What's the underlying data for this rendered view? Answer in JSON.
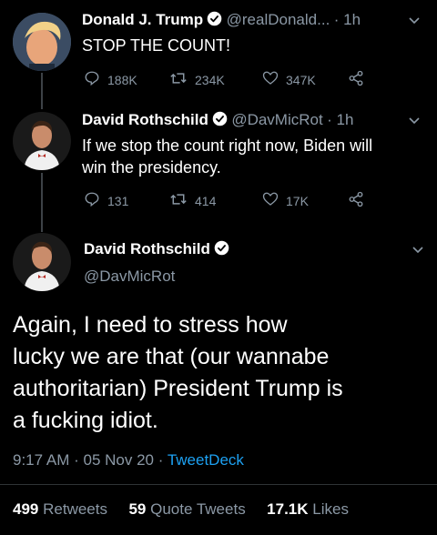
{
  "tweets": [
    {
      "name": "Donald J. Trump",
      "handle": "@realDonald...",
      "time": "· 1h",
      "text": "STOP THE COUNT!",
      "reply_count": "188K",
      "retweet_count": "234K",
      "like_count": "347K"
    },
    {
      "name": "David Rothschild",
      "handle": "@DavMicRot",
      "time": "· 1h",
      "text_line1": "If we stop the count right now, Biden will",
      "text_line2": "win the presidency.",
      "reply_count": "131",
      "retweet_count": "414",
      "like_count": "17K"
    }
  ],
  "main": {
    "name": "David Rothschild",
    "handle": "@DavMicRot",
    "text_lines": [
      "Again, I need to stress how",
      "lucky we are that (our wannabe",
      "authoritarian) President Trump is",
      "a fucking idiot."
    ],
    "time": "9:17 AM",
    "date": "05 Nov 20",
    "source": "TweetDeck",
    "retweets_count": "499",
    "retweets_label": "Retweets",
    "quotes_count": "59",
    "quotes_label": "Quote Tweets",
    "likes_count": "17.1K",
    "likes_label": "Likes"
  },
  "colors": {
    "accent": "#1da1f2",
    "muted": "#8b98a5",
    "text": "#ffffff",
    "background": "#000000"
  }
}
